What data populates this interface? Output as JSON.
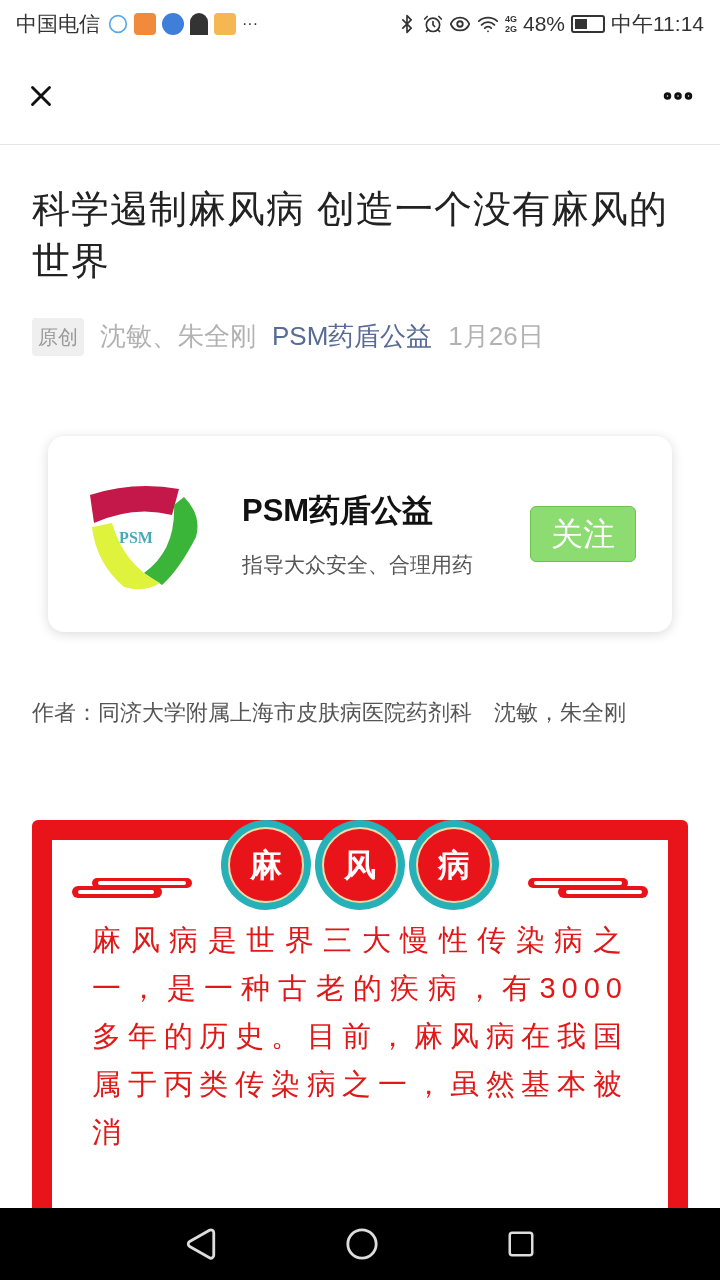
{
  "status_bar": {
    "carrier": "中国电信",
    "more": "···",
    "network": "4G\n2G",
    "battery": "48%",
    "time": "中午11:14"
  },
  "article": {
    "title": "科学遏制麻风病 创造一个没有麻风的世界",
    "badge": "原创",
    "authors": "沈敏、朱全刚",
    "account": "PSM药盾公益",
    "date": "1月26日"
  },
  "account_card": {
    "logo_text": "PSM",
    "name": "PSM药盾公益",
    "description": "指导大众安全、合理用药",
    "follow": "关注"
  },
  "author_line": "作者：同济大学附属上海市皮肤病医院药剂科　沈敏，朱全刚",
  "banner": {
    "heading": [
      "麻",
      "风",
      "病"
    ],
    "paragraph": "麻风病是世界三大慢性传染病之一，是一种古老的疾病，有3000多年的历史。目前，麻风病在我国属于丙类传染病之一，虽然基本被消"
  }
}
